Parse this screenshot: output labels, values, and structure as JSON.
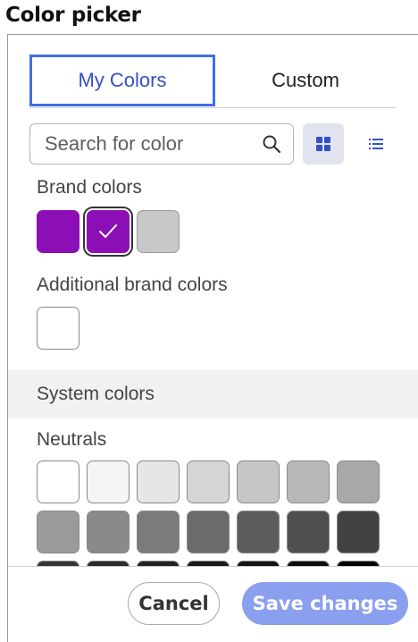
{
  "page": {
    "title": "Color picker"
  },
  "tabs": [
    {
      "label": "My Colors",
      "active": true
    },
    {
      "label": "Custom",
      "active": false
    }
  ],
  "search": {
    "placeholder": "Search for color",
    "icon": "search-icon"
  },
  "view_toggle": {
    "grid_icon": "grid-view-icon",
    "list_icon": "list-view-icon",
    "selected": "grid"
  },
  "brand": {
    "label": "Brand colors",
    "swatches": [
      {
        "color": "#8c0fb5",
        "selected": false
      },
      {
        "color": "#8c0fb5",
        "selected": true
      },
      {
        "color": "#c8c8c8",
        "selected": false
      }
    ]
  },
  "additional": {
    "label": "Additional brand colors"
  },
  "system": {
    "label": "System colors"
  },
  "neutrals": {
    "label": "Neutrals",
    "colors": [
      "#ffffff",
      "#f5f5f5",
      "#e6e6e6",
      "#d5d5d5",
      "#c6c6c6",
      "#b8b8b8",
      "#a8a8a8",
      "#9a9a9a",
      "#8a8a8a",
      "#7b7b7b",
      "#6b6b6b",
      "#5c5c5c",
      "#4f4f4f",
      "#424242",
      "#353535",
      "#2b2b2b",
      "#222222",
      "#1b1b1b",
      "#141414",
      "#0d0d0d",
      "#050505"
    ]
  },
  "footer": {
    "cancel_label": "Cancel",
    "save_label": "Save changes"
  },
  "colors": {
    "accent": "#3f6fe0",
    "save_button": "#8b9fef"
  }
}
